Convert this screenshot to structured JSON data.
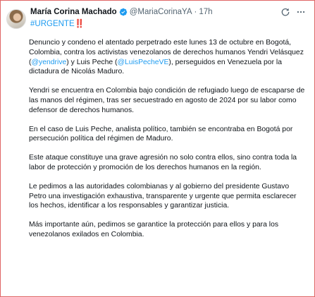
{
  "tweet": {
    "author_name": "María Corina Machado",
    "handle": "@MariaCorinaYA",
    "separator": "·",
    "time": "17h",
    "hashtag": "#URGENTE",
    "hashtag_suffix": "‼️",
    "p1_a": "Denuncio y condeno el atentado perpetrado este lunes 13 de octubre en Bogotá, Colombia, contra los activistas venezolanos de derechos humanos Yendri Velásquez (",
    "p1_mention1": "@yendrive",
    "p1_b": ") y Luis Peche (",
    "p1_mention2": "@LuisPecheVE",
    "p1_c": "), perseguidos en Venezuela por la dictadura de Nicolás Maduro.",
    "p2": "Yendri se encuentra en Colombia bajo condición de refugiado luego de escaparse de las manos del régimen, tras ser secuestrado en agosto de 2024 por su labor como defensor de derechos humanos.",
    "p3": "En el caso de Luis Peche, analista político, también se encontraba en Bogotá por persecución política del régimen de Maduro.",
    "p4": "Este ataque constituye una grave agresión no solo contra ellos, sino contra toda la labor de protección y promoción de los derechos humanos en la región.",
    "p5": "Le pedimos a las autoridades colombianas y al gobierno del presidente Gustavo Petro una investigación exhaustiva, transparente y urgente que permita esclarecer los hechos, identificar a los responsables y garantizar justicia.",
    "p6": "Más importante aún, pedimos se garantice la protección para ellos y para los venezolanos exilados en Colombia."
  },
  "icons": {
    "verified": "verified-badge-icon",
    "grok": "grok-icon",
    "more": "more-icon"
  },
  "colors": {
    "link": "#1d9bf0",
    "verified": "#1d9bf0",
    "muted": "#536471",
    "text": "#0f1419",
    "frame_border": "#e06666"
  }
}
